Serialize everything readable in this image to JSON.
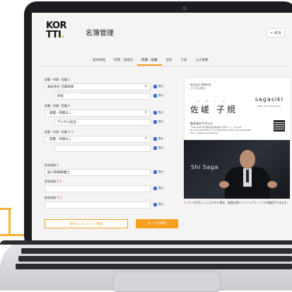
{
  "app": {
    "logo_top": "KOR",
    "logo_bottom": "TTI",
    "page_title": "名簿管理",
    "back_label": "← 戻る"
  },
  "tabs": [
    "基本情報",
    "所属・連絡先",
    "所属・役職",
    "住所",
    "写真",
    "公文書類"
  ],
  "active_tab_index": 2,
  "form": {
    "groups": [
      {
        "label": "部署・所属／役職 1",
        "select_value": "株式会社 営業本部",
        "sub_value": "係長",
        "check_label": "表示"
      },
      {
        "label": "部署・所属／役職 2",
        "select_value": "- 部署・所属なし -",
        "sub_value": "デジタル担当",
        "check_label": "表示"
      },
      {
        "label": "部署・所属／役職 3",
        "select_value": "- 部署・所属なし -",
        "sub_value": "",
        "check_label": "表示"
      }
    ],
    "qualification": {
      "label": "保有資格 1",
      "value": "個人情報保護士",
      "check_label": "表示"
    },
    "extra_1": {
      "label": "保有資格 2",
      "value": "",
      "check_label": "表示"
    },
    "extra_2": {
      "label": "保有資格 3",
      "value": "",
      "check_label": "表示"
    },
    "preview_button": "保存 & プレビュー更新",
    "save_button": "カードを保存"
  },
  "card": {
    "company_small": "株式会社 営業本部",
    "position_small": "デジタル担当",
    "ruby": "さがしき",
    "name": "佐嵯 子規",
    "brand": "sagasiki",
    "tagline": "Open Your Experience",
    "company": "株式会社サガシキ",
    "address": "〒000-0000 東京都渋谷区神宮前1丁目2-3 コーワビル9F",
    "contact": "Tel: 03-0000-0000  Fax: 03-0000-0000  Mobile: 090-0000-0000",
    "email": "Mail: s_sagasiki@sagasiki.jp"
  },
  "photo": {
    "signature": "Shi Saga"
  },
  "note": {
    "marker": "⓪",
    "text": "データが正しく入力された場合、画面右側でイメージプレートでの確認ができます。"
  },
  "colors": {
    "accent": "#f5a020",
    "checkbox": "#3b6fd1",
    "bezel": "#1c1d20"
  }
}
